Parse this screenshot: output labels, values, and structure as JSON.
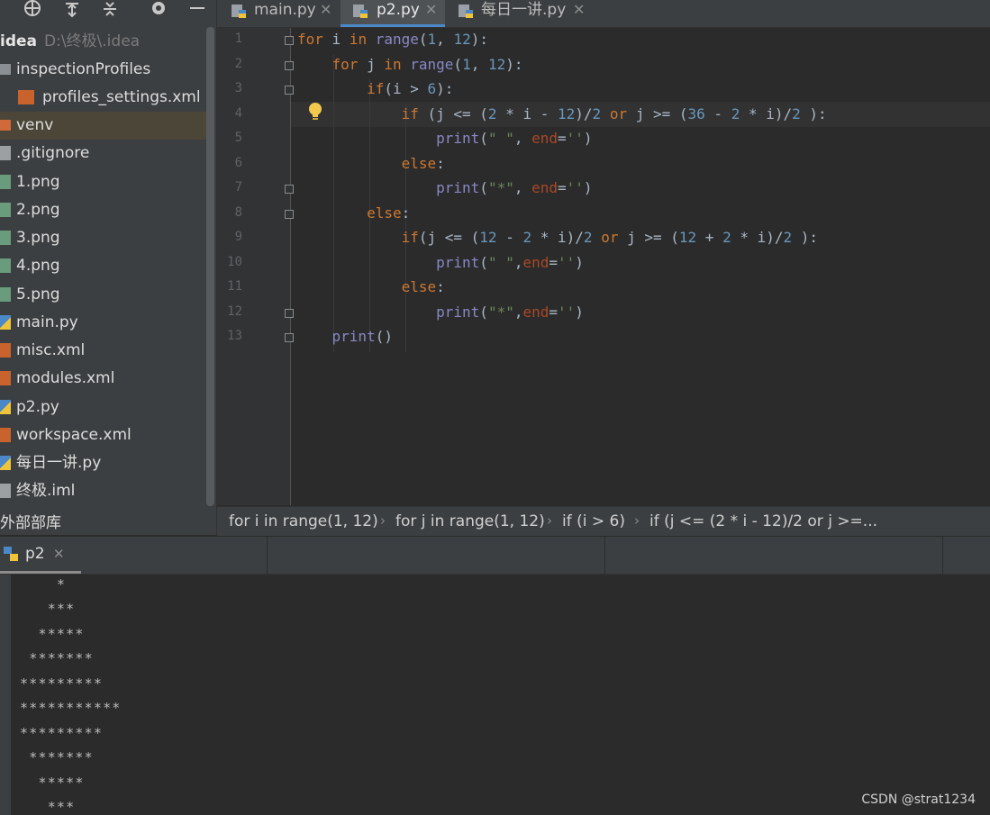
{
  "project": {
    "root_name": "idea",
    "root_path": "D:\\终极\\.idea",
    "items": [
      {
        "label": "inspectionProfiles",
        "type": "folder"
      },
      {
        "label": "profiles_settings.xml",
        "type": "xml"
      },
      {
        "label": "venv",
        "type": "folder"
      },
      {
        "label": ".gitignore",
        "type": "ignore"
      },
      {
        "label": "1.png",
        "type": "image"
      },
      {
        "label": "2.png",
        "type": "image"
      },
      {
        "label": "3.png",
        "type": "image"
      },
      {
        "label": "4.png",
        "type": "image"
      },
      {
        "label": "5.png",
        "type": "image"
      },
      {
        "label": "main.py",
        "type": "python"
      },
      {
        "label": "misc.xml",
        "type": "xml"
      },
      {
        "label": "modules.xml",
        "type": "xml"
      },
      {
        "label": "p2.py",
        "type": "python"
      },
      {
        "label": "workspace.xml",
        "type": "xml"
      },
      {
        "label": "每日一讲.py",
        "type": "python"
      },
      {
        "label": "终极.iml",
        "type": "iml"
      }
    ],
    "selected": "venv",
    "external_libraries": "外部部库"
  },
  "tabs": [
    {
      "label": "main.py",
      "active": false
    },
    {
      "label": "p2.py",
      "active": true
    },
    {
      "label": "每日一讲.py",
      "active": false
    }
  ],
  "editor": {
    "line_numbers": [
      "1",
      "2",
      "3",
      "4",
      "5",
      "6",
      "7",
      "8",
      "9",
      "10",
      "11",
      "12",
      "13"
    ],
    "current_line": "4"
  },
  "breadcrumb": [
    "for i in range(1, 12)",
    "for j in range(1, 12)",
    "if (i > 6)",
    "if (j <= (2 * i - 12)/2 or j >=..."
  ],
  "run": {
    "tab_label": "p2",
    "output": [
      "    *",
      "   ***",
      "  *****",
      " *******",
      "*********",
      "***********",
      "*********",
      " *******",
      "  *****",
      "   ***"
    ]
  },
  "watermark": "CSDN @strat1234",
  "colors": {
    "accent": "#4a88c7",
    "keyword": "#cc7832",
    "number": "#6897bb",
    "string": "#6a8759",
    "builtin": "#8888c6"
  }
}
